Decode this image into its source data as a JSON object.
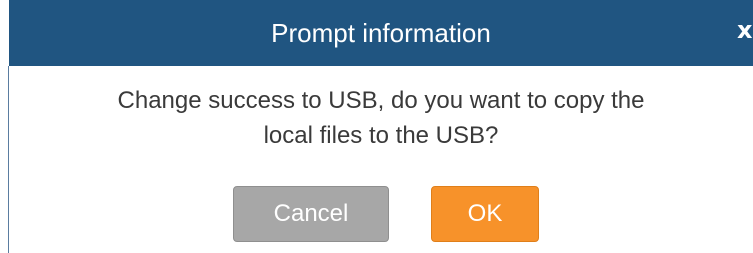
{
  "dialog": {
    "title": "Prompt information",
    "close_label": "x",
    "message_line1": "Change success to USB, do you want to copy the",
    "message_line2": "local files to the USB?",
    "cancel_label": "Cancel",
    "ok_label": "OK"
  },
  "colors": {
    "titlebar": "#205581",
    "ok_button": "#f7922a",
    "cancel_button": "#a7a7a7",
    "text": "#3a3a3a"
  },
  "icons": {
    "close": "close-icon"
  }
}
